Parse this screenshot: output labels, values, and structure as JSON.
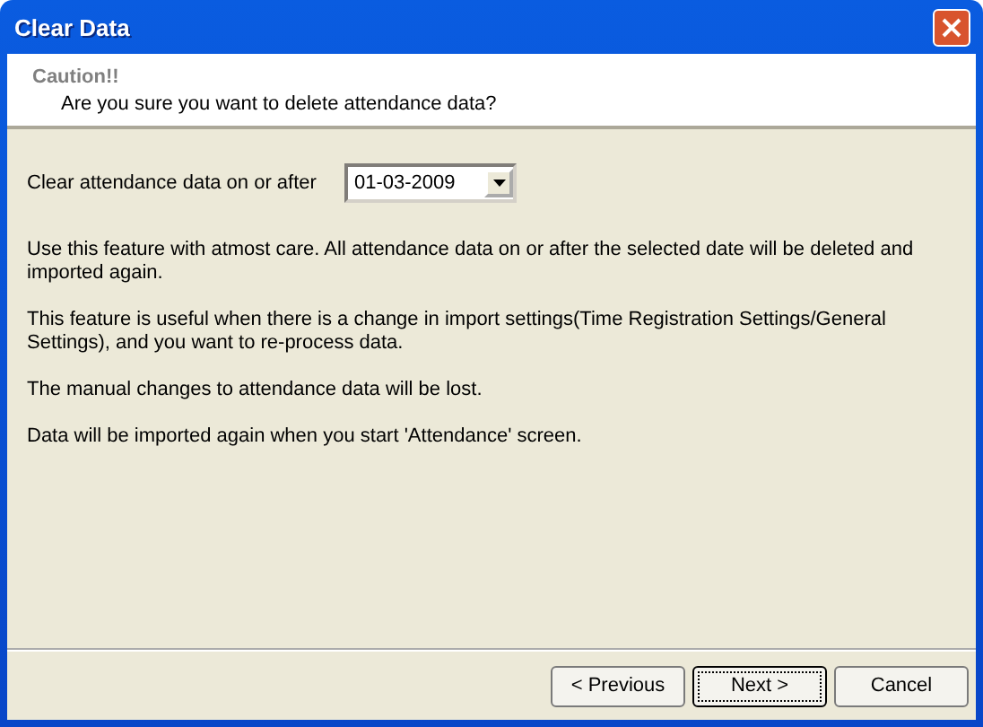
{
  "window": {
    "title": "Clear Data"
  },
  "header": {
    "title": "Caution!!",
    "subtitle": "Are you sure you want to delete attendance data?"
  },
  "date_field": {
    "label": "Clear attendance data on or after",
    "value": "01-03-2009"
  },
  "paragraphs": [
    "Use this feature with atmost care. All attendance data on or after the selected date will be deleted and imported again.",
    "This feature is useful when there is a change in import settings(Time Registration Settings/General Settings), and you want to re-process data.",
    "The manual changes to attendance data will be lost.",
    "Data will be imported again when you start 'Attendance' screen."
  ],
  "buttons": [
    {
      "label": "< Previous",
      "default": false
    },
    {
      "label": "Next >",
      "default": true
    },
    {
      "label": "Cancel",
      "default": false
    }
  ]
}
